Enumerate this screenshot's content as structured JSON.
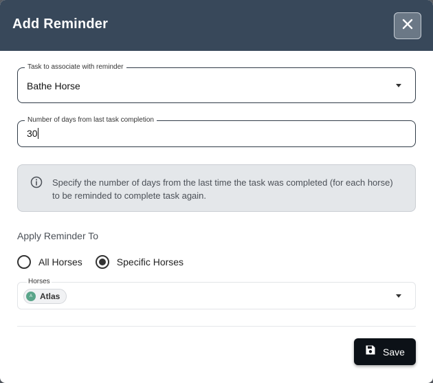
{
  "dialog": {
    "title": "Add Reminder",
    "close_icon": "close-icon",
    "colors": {
      "header": "#38485a",
      "save_button": "#0c1117",
      "chip_avatar": "#5aa58a"
    }
  },
  "task_field": {
    "label": "Task to associate with reminder",
    "value": "Bathe Horse",
    "icon": "chevron-down-icon"
  },
  "days_field": {
    "label": "Number of days from last task completion",
    "value": "30"
  },
  "info": {
    "icon": "info-icon",
    "text": "Specify the number of days from the last time the task was completed (for each horse) to be reminded to complete task again."
  },
  "apply": {
    "label": "Apply Reminder To",
    "options": [
      {
        "label": "All Horses",
        "selected": false
      },
      {
        "label": "Specific Horses",
        "selected": true
      }
    ]
  },
  "horses_field": {
    "label": "Horses",
    "chips": [
      {
        "avatar": "A",
        "label": "Atlas"
      }
    ],
    "icon": "chevron-down-icon"
  },
  "actions": {
    "save_label": "Save",
    "save_icon": "floppy-disk-icon"
  }
}
